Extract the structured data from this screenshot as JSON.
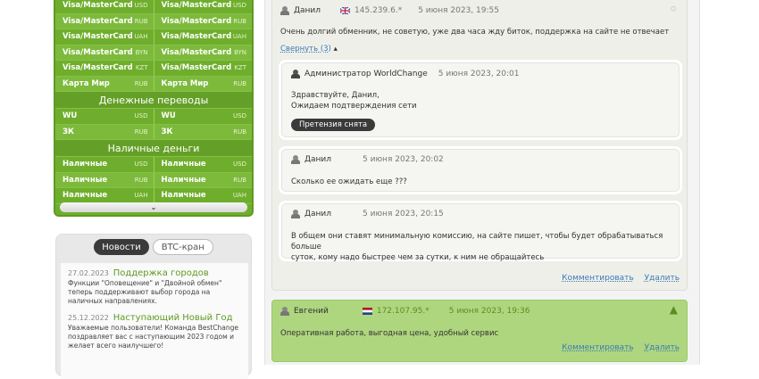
{
  "exchange": {
    "rows_top": [
      {
        "left": "Visa/MasterCard",
        "left_cur": "USD",
        "right": "Visa/MasterCard",
        "right_cur": "USD"
      },
      {
        "left": "Visa/MasterCard",
        "left_cur": "RUB",
        "right": "Visa/MasterCard",
        "right_cur": "RUB"
      },
      {
        "left": "Visa/MasterCard",
        "left_cur": "UAH",
        "right": "Visa/MasterCard",
        "right_cur": "UAH"
      },
      {
        "left": "Visa/MasterCard",
        "left_cur": "BYN",
        "right": "Visa/MasterCard",
        "right_cur": "BYN"
      },
      {
        "left": "Visa/MasterCard",
        "left_cur": "KZT",
        "right": "Visa/MasterCard",
        "right_cur": "KZT"
      },
      {
        "left": "Карта Мир",
        "left_cur": "RUB",
        "right": "Карта Мир",
        "right_cur": "RUB"
      }
    ],
    "section_transfers": "Денежные переводы",
    "rows_transfers": [
      {
        "left": "WU",
        "left_cur": "USD",
        "right": "WU",
        "right_cur": "USD"
      },
      {
        "left": "ЗК",
        "left_cur": "RUB",
        "right": "ЗК",
        "right_cur": "RUB"
      }
    ],
    "section_cash": "Наличные деньги",
    "rows_cash": [
      {
        "left": "Наличные",
        "left_cur": "USD",
        "right": "Наличные",
        "right_cur": "USD"
      },
      {
        "left": "Наличные",
        "left_cur": "RUB",
        "right": "Наличные",
        "right_cur": "RUB"
      },
      {
        "left": "Наличные",
        "left_cur": "UAH",
        "right": "Наличные",
        "right_cur": "UAH"
      }
    ],
    "expand_icon": "chevron-down-icon"
  },
  "news": {
    "tab_news": "Новости",
    "tab_btc": "BTC-кран",
    "items": [
      {
        "date": "27.02.2023",
        "title": "Поддержка городов",
        "text": "Функции \"Оповещение\" и \"Двойной обмен\" теперь поддерживают выбор города на наличных направлениях."
      },
      {
        "date": "25.12.2022",
        "title": "Наступающий Новый Год",
        "text": "Уважаемые пользователи! Команда BestChange поздравляет вас с наступающим 2023 годом и желает всего наилучшего!"
      }
    ]
  },
  "review1": {
    "author": "Данил",
    "ip": "145.239.6.*",
    "date": "5 июня 2023, 19:55",
    "text": "Очень долгий обменник, не советую, уже два часа жду биток, поддержка на сайте не отвечает",
    "collapse": "Свернуть (3)",
    "replies": [
      {
        "author": "Администратор WorldChange",
        "date": "5 июня 2023, 20:01",
        "line1": "Здравствуйте, Данил,",
        "line2": "Ожидаем подтверждения сети",
        "badge": "Претензия снята"
      },
      {
        "author": "Данил",
        "date": "5 июня 2023, 20:02",
        "line1": "Сколько ее ожидать еще ???"
      },
      {
        "author": "Данил",
        "date": "5 июня 2023, 20:15",
        "line1": "В общем они ставят минимальную комиссию, на сайте пишет, чтобы будет обрабатываться больше",
        "line2": "суток, кому надо быстрее чем за сутки, к ним не обращайтесь"
      }
    ],
    "comment": "Комментировать",
    "delete": "Удалить"
  },
  "review2": {
    "author": "Евгений",
    "ip": "172.107.95.*",
    "date": "5 июня 2023, 19:36",
    "text": "Оперативная работа, выгодная цена, удобный сервис",
    "comment": "Комментировать",
    "delete": "Удалить"
  },
  "colors": {
    "green": "#6fae2c",
    "accent_link": "#3a7ab6",
    "positive_bg": "#aed67e"
  }
}
